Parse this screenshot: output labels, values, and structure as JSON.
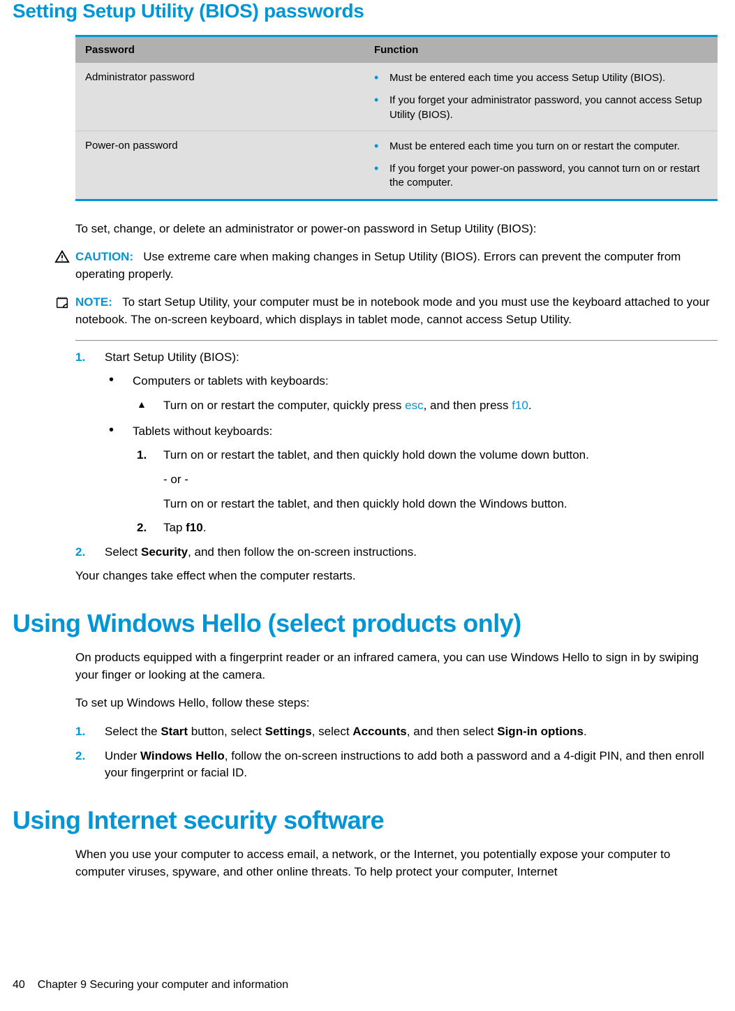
{
  "headings": {
    "h2_bios": "Setting Setup Utility (BIOS) passwords",
    "h1_hello": "Using Windows Hello (select products only)",
    "h1_sec": "Using Internet security software"
  },
  "table": {
    "header_password": "Password",
    "header_function": "Function",
    "rows": [
      {
        "name": "Administrator password",
        "functions": [
          "Must be entered each time you access Setup Utility (BIOS).",
          "If you forget your administrator password, you cannot access Setup Utility (BIOS)."
        ]
      },
      {
        "name": "Power-on password",
        "functions": [
          "Must be entered each time you turn on or restart the computer.",
          "If you forget your power-on password, you cannot turn on or restart the computer."
        ]
      }
    ]
  },
  "body": {
    "intro": "To set, change, or delete an administrator or power-on password in Setup Utility (BIOS):",
    "caution_label": "CAUTION:",
    "caution_text": "Use extreme care when making changes in Setup Utility (BIOS). Errors can prevent the computer from operating properly.",
    "note_label": "NOTE:",
    "note_text": "To start Setup Utility, your computer must be in notebook mode and you must use the keyboard attached to your notebook. The on-screen keyboard, which displays in tablet mode, cannot access Setup Utility.",
    "step1_num": "1.",
    "step1_text": "Start Setup Utility (BIOS):",
    "step1_sub1": "Computers or tablets with keyboards:",
    "step1_sub1_tri_pre": "Turn on or restart the computer, quickly press ",
    "step1_sub1_key1": "esc",
    "step1_sub1_mid": ", and then press ",
    "step1_sub1_key2": "f10",
    "step1_sub1_post": ".",
    "step1_sub2": "Tablets without keyboards:",
    "step1_sub2_n1_num": "1.",
    "step1_sub2_n1": "Turn on or restart the tablet, and then quickly hold down the volume down button.",
    "step1_sub2_or": "- or -",
    "step1_sub2_alt": "Turn on or restart the tablet, and then quickly hold down the Windows button.",
    "step1_sub2_n2_num": "2.",
    "step1_sub2_n2_pre": "Tap ",
    "step1_sub2_n2_key": "f10",
    "step1_sub2_n2_post": ".",
    "step2_num": "2.",
    "step2_pre": "Select ",
    "step2_bold": "Security",
    "step2_post": ", and then follow the on-screen instructions.",
    "closing": "Your changes take effect when the computer restarts."
  },
  "hello": {
    "p1": "On products equipped with a fingerprint reader or an infrared camera, you can use Windows Hello to sign in by swiping your finger or looking at the camera.",
    "p2": "To set up Windows Hello, follow these steps:",
    "s1_num": "1.",
    "s1_pre": "Select the ",
    "s1_b1": "Start",
    "s1_m1": " button, select ",
    "s1_b2": "Settings",
    "s1_m2": ", select ",
    "s1_b3": "Accounts",
    "s1_m3": ", and then select ",
    "s1_b4": "Sign-in options",
    "s1_post": ".",
    "s2_num": "2.",
    "s2_pre": "Under ",
    "s2_b1": "Windows Hello",
    "s2_post": ", follow the on-screen instructions to add both a password and a 4-digit PIN, and then enroll your fingerprint or facial ID."
  },
  "sec": {
    "p1": "When you use your computer to access email, a network, or the Internet, you potentially expose your computer to computer viruses, spyware, and other online threats. To help protect your computer, Internet"
  },
  "footer": {
    "page_num": "40",
    "chapter": "Chapter 9   Securing your computer and information"
  }
}
